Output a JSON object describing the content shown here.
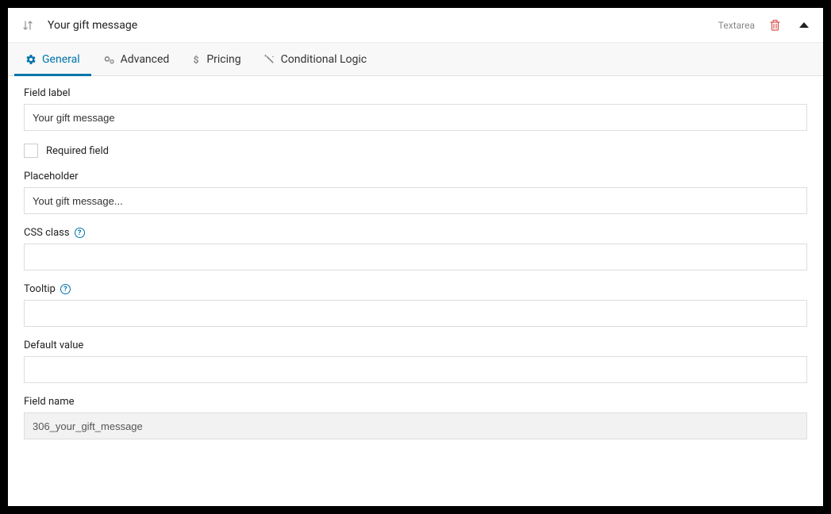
{
  "header": {
    "title": "Your gift message",
    "field_type": "Textarea"
  },
  "tabs": {
    "general": "General",
    "advanced": "Advanced",
    "pricing": "Pricing",
    "conditional": "Conditional Logic"
  },
  "form": {
    "field_label": {
      "label": "Field label",
      "value": "Your gift message"
    },
    "required": {
      "label": "Required field",
      "checked": false
    },
    "placeholder": {
      "label": "Placeholder",
      "value": "Yout gift message..."
    },
    "css_class": {
      "label": "CSS class",
      "value": ""
    },
    "tooltip": {
      "label": "Tooltip",
      "value": ""
    },
    "default_value": {
      "label": "Default value",
      "value": ""
    },
    "field_name": {
      "label": "Field name",
      "value": "306_your_gift_message"
    }
  }
}
